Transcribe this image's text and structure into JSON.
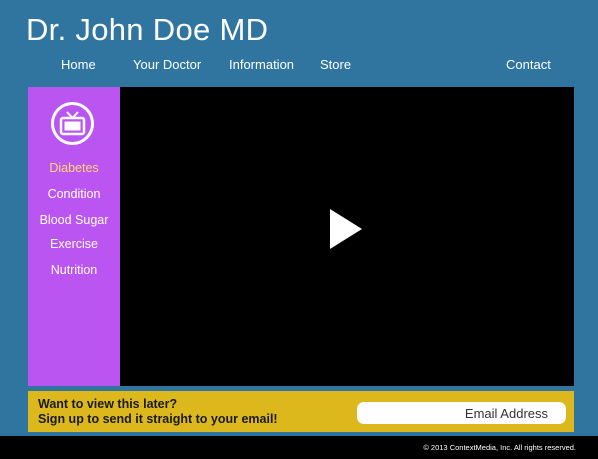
{
  "header": {
    "site_title": "Dr. John Doe MD"
  },
  "nav": {
    "items": [
      {
        "label": "Home"
      },
      {
        "label": "Your Doctor"
      },
      {
        "label": "Information"
      },
      {
        "label": "Store"
      },
      {
        "label": "Contact"
      }
    ]
  },
  "sidebar": {
    "icon": "tv-icon",
    "items": [
      {
        "label": "Diabetes",
        "active": true
      },
      {
        "label": "Condition",
        "active": false
      },
      {
        "label": "Blood Sugar",
        "active": false
      },
      {
        "label": "Exercise",
        "active": false
      },
      {
        "label": "Nutrition",
        "active": false
      }
    ]
  },
  "video": {
    "icon": "play-icon"
  },
  "signup": {
    "line1": "Want to view this later?",
    "line2": "Sign up to send it straight to your email!",
    "email_placeholder": "Email Address"
  },
  "footer": {
    "copyright": "© 2013 ContextMedia, Inc. All rights reserved."
  },
  "colors": {
    "background": "#2f75a0",
    "sidebar": "#bb55f2",
    "active_item": "#ffd86a",
    "signup_bar": "#dcb81c",
    "video": "#000000"
  }
}
